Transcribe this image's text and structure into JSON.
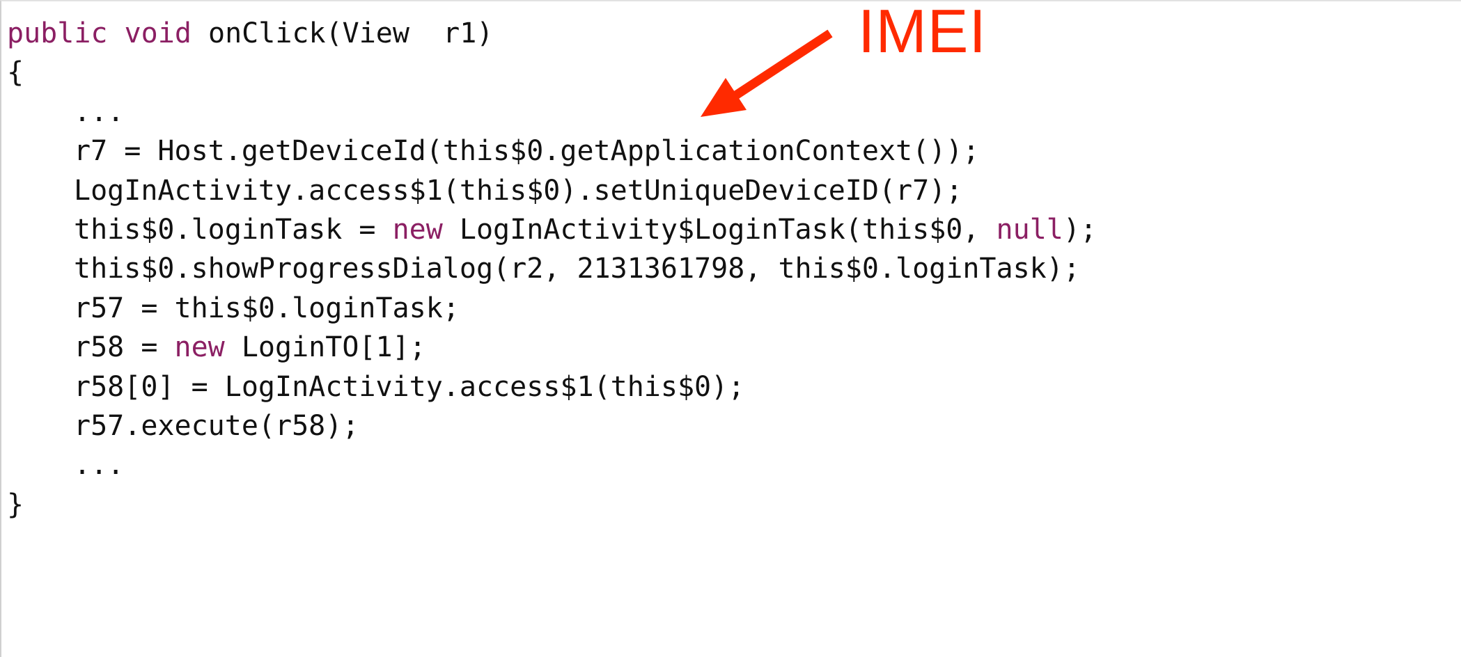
{
  "code": {
    "lines": [
      {
        "indent": 0,
        "tokens": [
          {
            "t": "public void ",
            "k": "kw"
          },
          {
            "t": "onClick(View  r1)",
            "k": "plain"
          }
        ]
      },
      {
        "indent": 0,
        "tokens": [
          {
            "t": "{",
            "k": "plain"
          }
        ]
      },
      {
        "indent": 1,
        "tokens": [
          {
            "t": "...",
            "k": "plain"
          }
        ]
      },
      {
        "indent": 1,
        "tokens": [
          {
            "t": "r7 = Host.getDeviceId(this$0.getApplicationContext());",
            "k": "plain"
          }
        ]
      },
      {
        "indent": 1,
        "tokens": [
          {
            "t": "LogInActivity.access$1(this$0).setUniqueDeviceID(r7);",
            "k": "plain"
          }
        ]
      },
      {
        "indent": 1,
        "tokens": [
          {
            "t": "this$0.loginTask = ",
            "k": "plain"
          },
          {
            "t": "new",
            "k": "kw"
          },
          {
            "t": " LogInActivity$LoginTask(this$0, ",
            "k": "plain"
          },
          {
            "t": "null",
            "k": "kw"
          },
          {
            "t": ");",
            "k": "plain"
          }
        ]
      },
      {
        "indent": 1,
        "tokens": [
          {
            "t": "this$0.showProgressDialog(r2, 2131361798, this$0.loginTask);",
            "k": "plain"
          }
        ]
      },
      {
        "indent": 1,
        "tokens": [
          {
            "t": "r57 = this$0.loginTask;",
            "k": "plain"
          }
        ]
      },
      {
        "indent": 1,
        "tokens": [
          {
            "t": "r58 = ",
            "k": "plain"
          },
          {
            "t": "new",
            "k": "kw"
          },
          {
            "t": " LoginTO[1];",
            "k": "plain"
          }
        ]
      },
      {
        "indent": 1,
        "tokens": [
          {
            "t": "r58[0] = LogInActivity.access$1(this$0);",
            "k": "plain"
          }
        ]
      },
      {
        "indent": 1,
        "tokens": [
          {
            "t": "r57.execute(r58);",
            "k": "plain"
          }
        ]
      },
      {
        "indent": 1,
        "tokens": [
          {
            "t": "...",
            "k": "plain"
          }
        ]
      },
      {
        "indent": 0,
        "tokens": [
          {
            "t": "}",
            "k": "plain"
          }
        ]
      }
    ]
  },
  "annotation": {
    "label": "IMEI",
    "color": "#ff2a00"
  },
  "colors": {
    "keyword": "#8b1f63",
    "text": "#111111",
    "background": "#ffffff"
  }
}
